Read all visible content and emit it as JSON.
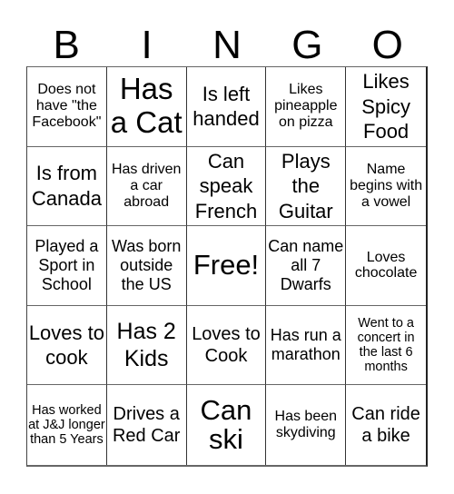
{
  "header": {
    "letters": [
      "B",
      "I",
      "N",
      "G",
      "O"
    ]
  },
  "cells": [
    [
      "Does not have \"the Facebook\"",
      "Has a Cat",
      "Is left handed",
      "Likes pineapple on pizza",
      "Likes Spicy Food"
    ],
    [
      "Is from Canada",
      "Has driven a car abroad",
      "Can speak French",
      "Plays the Guitar",
      "Name begins with a vowel"
    ],
    [
      "Played a Sport in School",
      "Was born outside the US",
      "Free!",
      "Can name all 7 Dwarfs",
      "Loves chocolate"
    ],
    [
      "Loves to cook",
      "Has 2 Kids",
      "Loves to Cook",
      "Has run a marathon",
      "Went to a concert in the last 6 months"
    ],
    [
      "Has worked at J&J longer than 5 Years",
      "Drives a Red Car",
      "Can ski",
      "Has been skydiving",
      "Can ride a bike"
    ]
  ]
}
